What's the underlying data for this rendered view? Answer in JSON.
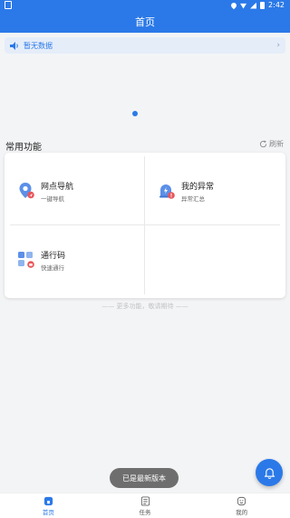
{
  "status_bar": {
    "time": "2:42"
  },
  "app_bar": {
    "title": "首页"
  },
  "notice": {
    "text": "暂无数据",
    "speaker_icon": "speaker-icon",
    "chevron_icon": "chevron-right-icon"
  },
  "section": {
    "title": "常用功能",
    "refresh_label": "刷新"
  },
  "functions": [
    {
      "title": "网点导航",
      "subtitle": "一键导航",
      "icon": "location-pin-icon"
    },
    {
      "title": "我的异常",
      "subtitle": "异常汇总",
      "icon": "alert-icon"
    },
    {
      "title": "通行码",
      "subtitle": "快速通行",
      "icon": "grid-code-icon"
    }
  ],
  "more_text": "—— 更多功能，敬请期待 ——",
  "toast": "已是最新版本",
  "fab_icon": "bell-icon",
  "tabs": [
    {
      "label": "首页",
      "icon": "home-icon",
      "active": true
    },
    {
      "label": "任务",
      "icon": "task-list-icon",
      "active": false
    },
    {
      "label": "我的",
      "icon": "user-icon",
      "active": false
    }
  ],
  "colors": {
    "primary": "#2b79e8",
    "badge": "#e8565a",
    "icon_light": "#8fb4ee"
  }
}
